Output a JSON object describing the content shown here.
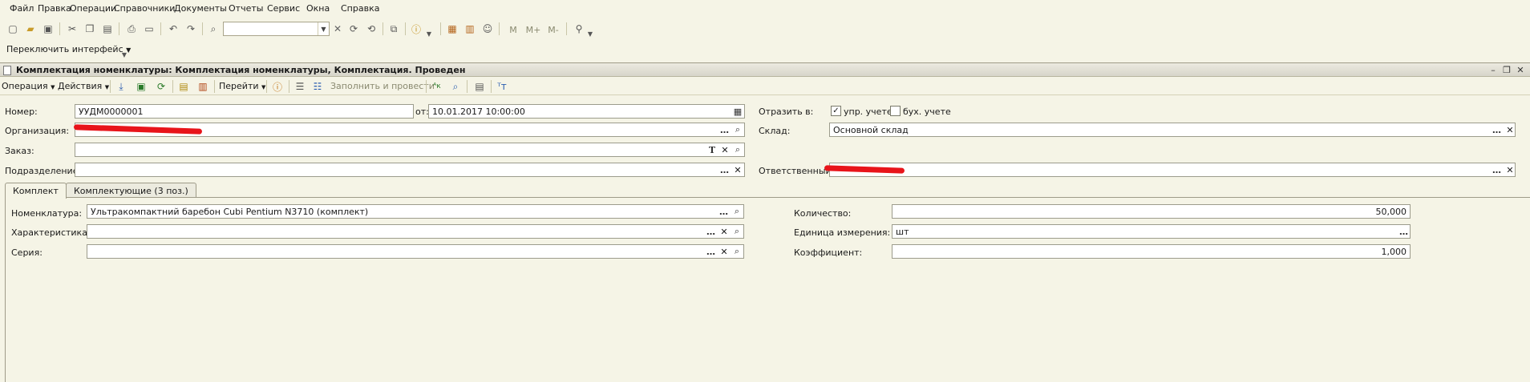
{
  "menu": {
    "items": [
      "Файл",
      "Правка",
      "Операции",
      "Справочники",
      "Документы",
      "Отчеты",
      "Сервис",
      "Окна",
      "Справка"
    ]
  },
  "toolbar": {
    "switch_interface": "Переключить интерфейс",
    "search_value": "",
    "text_buttons": [
      "М",
      "М+",
      "М-"
    ]
  },
  "document": {
    "title": "Комплектация номенклатуры: Комплектация номенклатуры, Комплектация. Проведен",
    "toolbar": {
      "operation": "Операция",
      "actions": "Действия",
      "goto": "Перейти",
      "fill_and_post": "Заполнить и провести"
    },
    "header": {
      "number_label": "Номер:",
      "number_value": "УУДМ0000001",
      "date_label": "от:",
      "date_value": "10.01.2017 10:00:00",
      "reflect_label": "Отразить в:",
      "mgmt_accounting_label": "упр. учете",
      "mgmt_accounting_checked": true,
      "acc_accounting_label": "бух. учете",
      "acc_accounting_checked": false,
      "org_label": "Организация:",
      "org_value": "",
      "warehouse_label": "Склад:",
      "warehouse_value": "Основной склад",
      "order_label": "Заказ:",
      "order_value": "",
      "department_label": "Подразделение:",
      "department_value": "",
      "responsible_label": "Ответственный:",
      "responsible_value": ""
    },
    "tabs": [
      {
        "label": "Комплект",
        "active": true
      },
      {
        "label": "Комплектующие (3 поз.)",
        "active": false
      }
    ],
    "kit": {
      "nomenclature_label": "Номенклатура:",
      "nomenclature_value": "Ультракомпактний баребон Cubi Pentium N3710 (комплект)",
      "characteristic_label": "Характеристика:",
      "characteristic_value": "",
      "series_label": "Серия:",
      "series_value": "",
      "quantity_label": "Количество:",
      "quantity_value": "50,000",
      "unit_label": "Единица измерения:",
      "unit_value": "шт",
      "coefficient_label": "Коэффициент:",
      "coefficient_value": "1,000"
    }
  },
  "colors": {
    "background": "#f5f4e6",
    "redaction": "#e8141a"
  }
}
